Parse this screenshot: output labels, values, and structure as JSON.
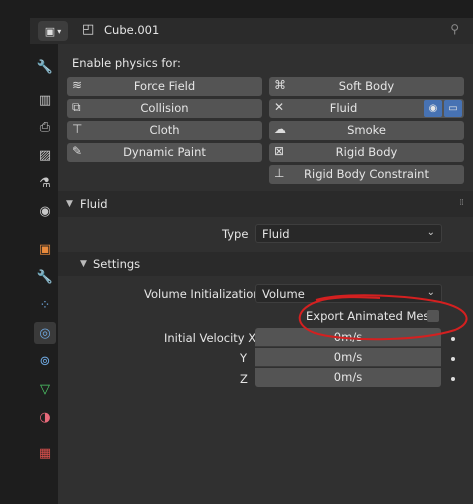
{
  "header": {
    "object_name": "Cube.001"
  },
  "physics": {
    "enable_label": "Enable physics for:",
    "buttons": [
      {
        "label": "Force Field",
        "icon": "force-field-icon"
      },
      {
        "label": "Soft Body",
        "icon": "soft-body-icon"
      },
      {
        "label": "Collision",
        "icon": "collision-icon"
      },
      {
        "label": "Fluid",
        "icon": "remove-icon"
      },
      {
        "label": "Cloth",
        "icon": "cloth-icon"
      },
      {
        "label": "Smoke",
        "icon": "smoke-icon"
      },
      {
        "label": "Dynamic Paint",
        "icon": "dynamic-paint-icon"
      },
      {
        "label": "Rigid Body",
        "icon": "rigid-body-icon"
      },
      {
        "label": "Rigid Body Constraint",
        "icon": "rigid-body-constraint-icon"
      }
    ]
  },
  "fluid": {
    "title": "Fluid",
    "type_label": "Type",
    "type_value": "Fluid",
    "settings": {
      "title": "Settings",
      "volume_init_label": "Volume Initialization",
      "volume_init_value": "Volume",
      "export_label": "Export Animated Mesh",
      "export_checked": false,
      "velocity": {
        "x_label": "Initial Velocity X",
        "x_value": "0m/s",
        "y_label": "Y",
        "y_value": "0m/s",
        "z_label": "Z",
        "z_value": "0m/s"
      }
    }
  },
  "colors": {
    "panel": "#303030",
    "button": "#545454",
    "accent": "#4772b3",
    "annotation": "#d42020"
  }
}
